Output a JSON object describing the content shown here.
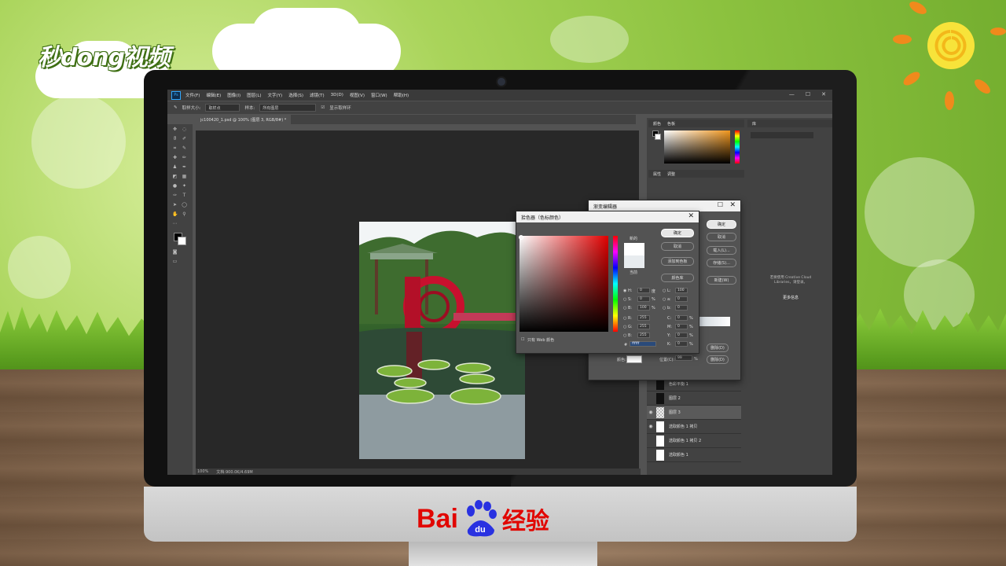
{
  "branding": {
    "top_logo": "秒dong视频",
    "baidu_latin": "Bai",
    "baidu_paw": "du",
    "baidu_cn": "经验"
  },
  "colors": {
    "accent_red": "#e10601",
    "ps_blue": "#31a8ff"
  },
  "app": {
    "logo": "Ps",
    "menu": [
      "文件(F)",
      "编辑(E)",
      "图像(I)",
      "图层(L)",
      "文字(Y)",
      "选择(S)",
      "滤镜(T)",
      "3D(D)",
      "视图(V)",
      "窗口(W)",
      "帮助(H)"
    ],
    "window_controls": [
      "—",
      "☐",
      "✕"
    ]
  },
  "options_bar": {
    "sample_size_label": "取样大小:",
    "sample_size_value": "取样点",
    "sample_label": "样本:",
    "sample_value": "所有图层",
    "show_ring_label": "显示取样环"
  },
  "document": {
    "tab_title": "jc100420_1.psd @ 100% (图层 3, RGB/8#) *",
    "zoom": "100%",
    "doc_size": "文档:900.0K/4.69M"
  },
  "panels": {
    "color_tabs": [
      "颜色",
      "色板"
    ],
    "properties_tabs": [
      "属性",
      "调整"
    ],
    "library_tab": "库",
    "libraries_message": "若要使用 Creative Cloud Libraries，请登录。",
    "libraries_link": "更多信息"
  },
  "color_picker": {
    "title": "拾色器（色标颜色）",
    "ok": "确定",
    "cancel": "取消",
    "add_to_swatches": "添加到色板",
    "color_libraries": "颜色库",
    "new_label": "新的",
    "current_label": "当前",
    "only_web": "只有 Web 颜色",
    "fields": {
      "H": {
        "value": "0",
        "unit": "度"
      },
      "S": {
        "value": "0",
        "unit": "%"
      },
      "B": {
        "value": "100",
        "unit": "%"
      },
      "R": {
        "value": "255"
      },
      "G": {
        "value": "255"
      },
      "Bl": {
        "value": "255"
      },
      "L": {
        "value": "100"
      },
      "a": {
        "value": "0"
      },
      "b": {
        "value": "0"
      },
      "C": {
        "value": "0",
        "unit": "%"
      },
      "M": {
        "value": "0",
        "unit": "%"
      },
      "Y": {
        "value": "0",
        "unit": "%"
      },
      "K": {
        "value": "0",
        "unit": "%"
      }
    },
    "hex": "ffffff"
  },
  "gradient_editor": {
    "title": "渐变编辑器",
    "ok": "确定",
    "cancel": "取消",
    "load": "载入(L)...",
    "save": "存储(S)...",
    "new": "新建(W)",
    "color_label": "颜色:",
    "location_label": "位置(C):",
    "location_value": "99",
    "location_unit": "%",
    "delete": "删除(D)",
    "delete_top": "删除(D)"
  },
  "layers": [
    {
      "name": "色彩平衡 1",
      "thumb": "dark"
    },
    {
      "name": "图层 2",
      "thumb": "dark"
    },
    {
      "name": "图层 3",
      "thumb": "check",
      "selected": true
    },
    {
      "name": "选取颜色 1 拷贝",
      "thumb": "white"
    },
    {
      "name": "选取颜色 1 拷贝 2",
      "thumb": "white"
    },
    {
      "name": "选取颜色 1",
      "thumb": "white"
    }
  ]
}
